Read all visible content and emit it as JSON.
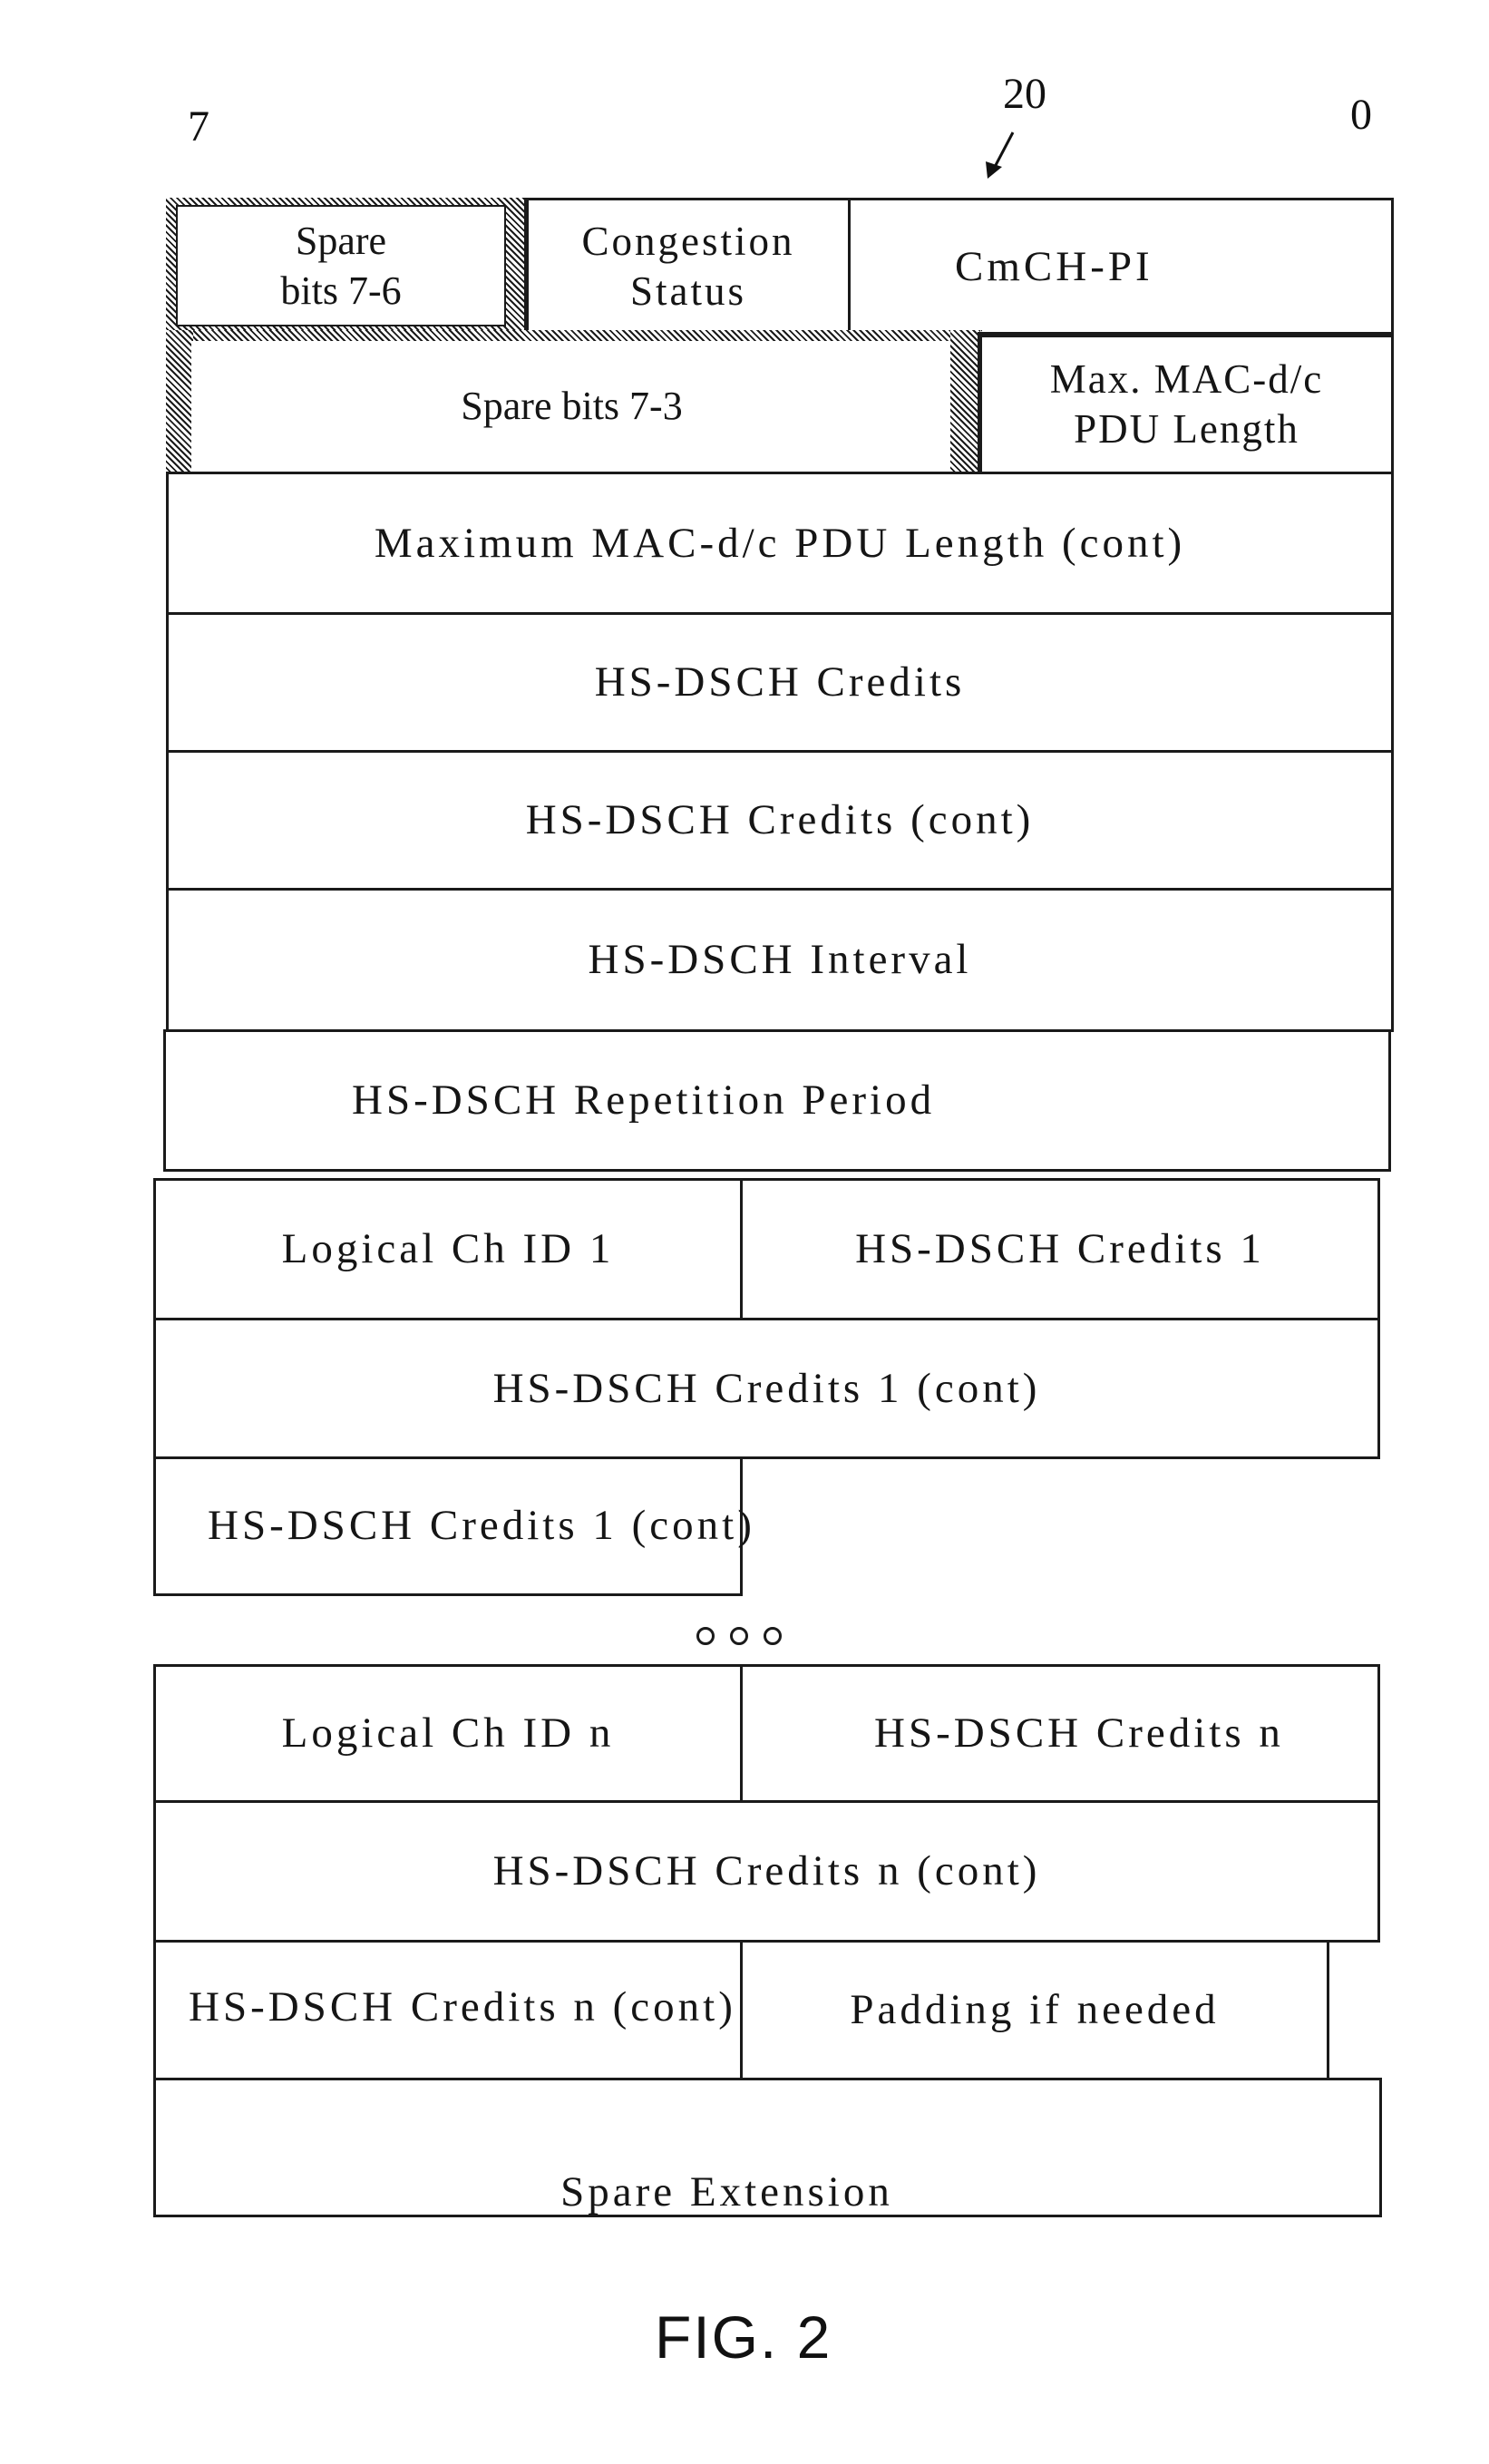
{
  "figure": {
    "caption": "FIG. 2",
    "reference_numeral": "20",
    "bit_labels": {
      "msb": "7",
      "lsb": "0"
    }
  },
  "frame": {
    "header": {
      "spare_bits_7_6": [
        "Spare",
        "bits 7-6"
      ],
      "congestion_status": [
        "Congestion",
        "Status"
      ],
      "cmch_pi": "CmCH-PI",
      "spare_bits_7_3": "Spare bits 7-3",
      "max_mac_pdu_length": [
        "Max. MAC-d/c",
        "PDU Length"
      ],
      "max_mac_pdu_length_cont": "Maximum MAC-d/c PDU Length (cont)",
      "hs_dsch_credits": "HS-DSCH Credits",
      "hs_dsch_credits_cont": "HS-DSCH Credits (cont)",
      "hs_dsch_interval": "HS-DSCH Interval",
      "hs_dsch_repetition_period": "HS-DSCH Repetition Period"
    },
    "channel_first": {
      "logical_ch_id": "Logical Ch ID 1",
      "credits": "HS-DSCH Credits 1",
      "credits_cont": "HS-DSCH Credits 1 (cont)",
      "credits_cont_2": "HS-DSCH Credits 1 (cont)"
    },
    "ellipsis": "ooo",
    "channel_last": {
      "logical_ch_id": "Logical Ch ID n",
      "credits": "HS-DSCH Credits n",
      "credits_cont": "HS-DSCH Credits n (cont)",
      "credits_cont_2": "HS-DSCH Credits n (cont)",
      "padding": "Padding if needed"
    },
    "spare_extension": "Spare Extension"
  }
}
